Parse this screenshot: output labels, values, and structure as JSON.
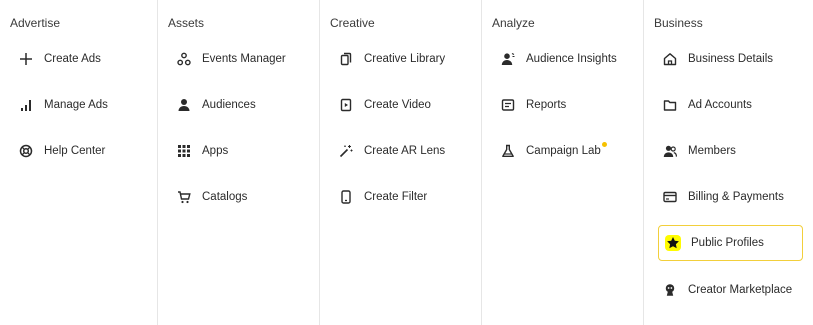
{
  "columns": [
    {
      "heading": "Advertise",
      "items": [
        {
          "label": "Create Ads",
          "icon": "plus-icon"
        },
        {
          "label": "Manage Ads",
          "icon": "bar-chart-icon"
        },
        {
          "label": "Help Center",
          "icon": "lifebuoy-icon"
        }
      ]
    },
    {
      "heading": "Assets",
      "items": [
        {
          "label": "Events Manager",
          "icon": "events-icon"
        },
        {
          "label": "Audiences",
          "icon": "person-icon"
        },
        {
          "label": "Apps",
          "icon": "grid-icon"
        },
        {
          "label": "Catalogs",
          "icon": "cart-icon"
        }
      ]
    },
    {
      "heading": "Creative",
      "items": [
        {
          "label": "Creative Library",
          "icon": "library-icon"
        },
        {
          "label": "Create Video",
          "icon": "video-icon"
        },
        {
          "label": "Create AR Lens",
          "icon": "magic-wand-icon"
        },
        {
          "label": "Create Filter",
          "icon": "phone-icon"
        }
      ]
    },
    {
      "heading": "Analyze",
      "items": [
        {
          "label": "Audience Insights",
          "icon": "insights-icon"
        },
        {
          "label": "Reports",
          "icon": "reports-icon"
        },
        {
          "label": "Campaign Lab",
          "icon": "flask-icon",
          "badge_color": "#f6c100"
        }
      ]
    },
    {
      "heading": "Business",
      "items": [
        {
          "label": "Business Details",
          "icon": "home-icon"
        },
        {
          "label": "Ad Accounts",
          "icon": "folder-icon"
        },
        {
          "label": "Members",
          "icon": "members-icon"
        },
        {
          "label": "Billing & Payments",
          "icon": "card-icon"
        },
        {
          "label": "Public Profiles",
          "icon": "star-icon",
          "active": true
        },
        {
          "label": "Creator Marketplace",
          "icon": "creator-icon"
        }
      ]
    }
  ],
  "colors": {
    "accent_yellow": "#fffc00",
    "active_border": "#f2cf3b",
    "notification_dot": "#f6c100",
    "divider": "#e6e6e6",
    "text": "#2b2b2b"
  }
}
